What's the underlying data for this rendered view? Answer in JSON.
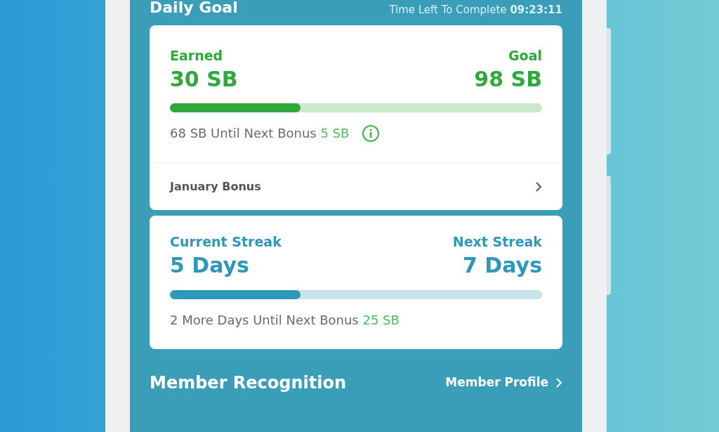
{
  "header": {
    "title": "Daily Goal",
    "timer": "Time Left To Complete **09:23:11**"
  },
  "goal_card": {
    "earned_label": "Earned",
    "earned_value": "30 SB",
    "goal_label": "Goal",
    "goal_value": "98 SB",
    "level": 0.35,
    "note": "68 SB Until Next Bonus",
    "note_bonus": "5 SB",
    "link": "January Bonus"
  },
  "streak_card": {
    "current_label": "Current Streak",
    "current_value": "5 Days",
    "next_label": "Next Streak",
    "next_value": "7 Days",
    "level": 0.35,
    "note": "2 More Days Until Next Bonus",
    "note_bonus": "25 SB"
  },
  "section": {
    "title": "Member Recognition",
    "link": "Member Profile"
  }
}
